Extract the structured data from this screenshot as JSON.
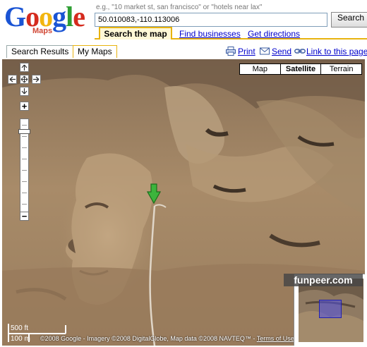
{
  "logo": {
    "text": "Google",
    "letters": [
      "G",
      "o",
      "o",
      "g",
      "l",
      "e"
    ],
    "letter_colors": [
      "#1a54d4",
      "#d52b1e",
      "#f2b50f",
      "#1a54d4",
      "#2f9f34",
      "#d52b1e"
    ],
    "subtitle": "Maps"
  },
  "search": {
    "hint": "e.g., \"10 market st, san francisco\" or \"hotels near lax\"",
    "value": "50.010083,-110.113006",
    "button_label": "Search Maps"
  },
  "header_tabs": {
    "search_map": "Search the map",
    "find_businesses": "Find businesses",
    "get_directions": "Get directions"
  },
  "side_tabs": [
    "Search Results",
    "My Maps"
  ],
  "toolbar": {
    "print": "Print",
    "send": "Send",
    "link": "Link to this page"
  },
  "map": {
    "types": [
      "Map",
      "Satellite",
      "Terrain"
    ],
    "selected_type": "Satellite",
    "pan_icons": [
      "arrow-up-icon",
      "arrow-left-icon",
      "center-icon",
      "arrow-right-icon",
      "arrow-down-icon"
    ],
    "zoom_in": "+",
    "zoom_out": "−",
    "scale": {
      "upper": "500 ft",
      "lower": "100 m"
    },
    "copyright": "©2008 Google - Imagery ©2008 DigitalGlobe, Map data ©2008 NAVTEQ™ - ",
    "terms": "Terms of Use",
    "marker_color": "#3cb43c"
  },
  "watermark": "funpeer.com",
  "colors": {
    "link": "#0000cc",
    "tab_accent": "#e8b30f",
    "overview_box": "#5050e6"
  }
}
